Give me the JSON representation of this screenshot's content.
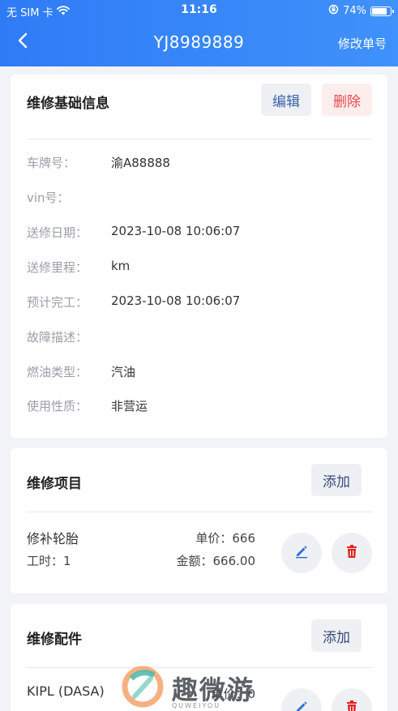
{
  "status_bar": {
    "carrier": "无 SIM 卡",
    "time": "11:16",
    "battery": "74%"
  },
  "nav": {
    "title": "YJ8989889",
    "action": "修改单号"
  },
  "basic_info": {
    "title": "维修基础信息",
    "edit_label": "编辑",
    "delete_label": "删除",
    "fields": [
      {
        "label": "车牌号：",
        "value": "渝A88888"
      },
      {
        "label": "vin号：",
        "value": ""
      },
      {
        "label": "送修日期：",
        "value": "2023-10-08 10:06:07"
      },
      {
        "label": "送修里程：",
        "value": "km"
      },
      {
        "label": "预计完工：",
        "value": "2023-10-08 10:06:07"
      },
      {
        "label": "故障描述：",
        "value": ""
      },
      {
        "label": "燃油类型：",
        "value": "汽油"
      },
      {
        "label": "使用性质：",
        "value": "非营运"
      }
    ]
  },
  "repair_items": {
    "title": "维修项目",
    "add_label": "添加",
    "items": [
      {
        "name": "修补轮胎",
        "hours": "工时：1",
        "price": "单价：666",
        "amount": "金额：666.00"
      }
    ]
  },
  "repair_parts": {
    "title": "维修配件",
    "add_label": "添加",
    "items": [
      {
        "name": "KIPL (DASA)",
        "price": "单价：0"
      }
    ]
  },
  "watermark": {
    "text": "趣微游",
    "sub": "QUWEIYOU"
  },
  "colors": {
    "header_start": "#2f7bf6",
    "header_end": "#3f91fb",
    "delete_red": "#e5484d",
    "edit_blue": "#3a63a8"
  },
  "icons": [
    "back-arrow-icon",
    "wifi-icon",
    "orientation-lock-icon",
    "battery-icon",
    "pencil-icon",
    "trash-icon"
  ]
}
